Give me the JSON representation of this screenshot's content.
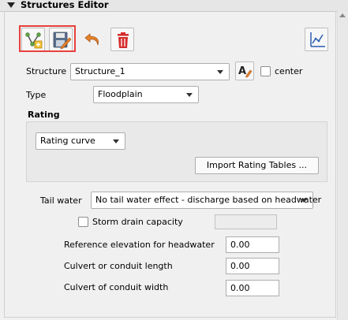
{
  "panel": {
    "title": "Structures Editor"
  },
  "toolbar": {
    "add_structure_icon": "structure-add-icon",
    "save_icon": "save-edit-icon",
    "undo_icon": "undo-icon",
    "delete_icon": "trash-icon",
    "right_tool_icon": "axes-profile-icon"
  },
  "structure": {
    "label": "Structure",
    "value": "Structure_1",
    "rename_icon": "rename-text-icon",
    "center_label": "center",
    "center_checked": false
  },
  "type": {
    "label": "Type",
    "value": "Floodplain"
  },
  "rating": {
    "heading": "Rating",
    "value": "Rating curve",
    "import_button": "Import Rating Tables ..."
  },
  "tail_water": {
    "label": "Tail water",
    "value": "No tail water effect - discharge based on headwater"
  },
  "storm_drain": {
    "label": "Storm drain capacity",
    "checked": false,
    "value": ""
  },
  "fields": {
    "ref_elev_label": "Reference elevation for headwater",
    "ref_elev_value": "0.00",
    "culvert_length_label": "Culvert or conduit length",
    "culvert_length_value": "0.00",
    "culvert_width_label": "Culvert of conduit width",
    "culvert_width_value": "0.00"
  },
  "colors": {
    "highlight_frame": "#e8403c",
    "undo_orange": "#e8832a",
    "delete_red": "#d62b2b",
    "icon_blue": "#2a5db0"
  }
}
